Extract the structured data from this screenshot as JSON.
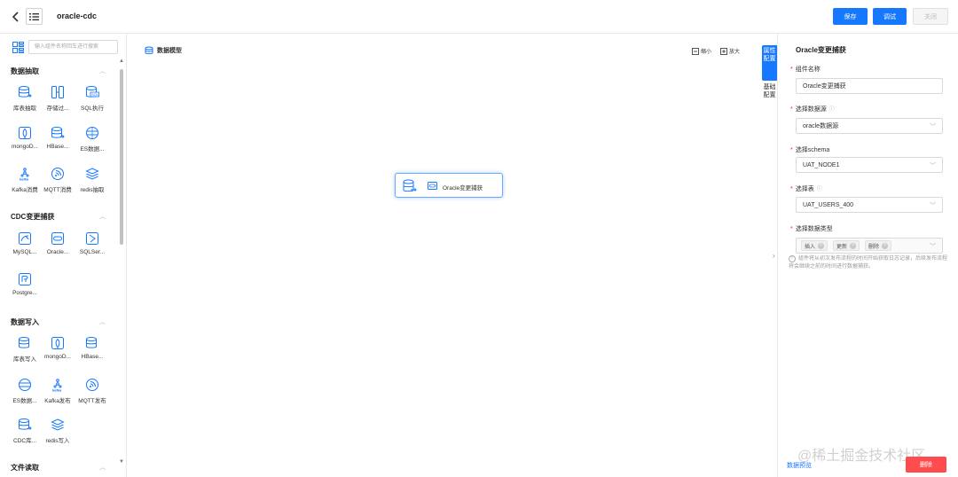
{
  "header": {
    "title": "oracle-cdc",
    "save_label": "保存",
    "debug_label": "调试",
    "close_label": "关闭"
  },
  "sidebar": {
    "search_placeholder": "输入组件名称回车进行搜索",
    "sections": [
      {
        "title": "数据抽取",
        "items": [
          "库表抽取",
          "存储过...",
          "SQL执行",
          "mongoD...",
          "HBase...",
          "ES数据...",
          "Kafka消费",
          "MQTT消费",
          "redis抽取"
        ]
      },
      {
        "title": "CDC变更捕获",
        "items": [
          "MySQL...",
          "Oracle...",
          "SQLSer...",
          "Postgre..."
        ]
      },
      {
        "title": "数据写入",
        "items": [
          "库表写入",
          "mongoD...",
          "HBase...",
          "ES数据...",
          "Kafka发布",
          "MQTT发布",
          "CDC库...",
          "redis写入"
        ]
      },
      {
        "title": "文件读取"
      }
    ]
  },
  "canvas": {
    "title": "数据模型",
    "zoom_out_label": "缩小",
    "zoom_in_label": "放大",
    "node_label": "Oracle变更捕获"
  },
  "tabs": {
    "properties": "属性配置",
    "basic": "基础配置"
  },
  "panel": {
    "title": "Oracle变更捕获",
    "component_name_label": "组件名称",
    "component_name_value": "Oracle变更捕获",
    "datasource_label": "选择数据源",
    "datasource_value": "oracle数据源",
    "schema_label": "选择schema",
    "schema_value": "UAT_NODE1",
    "table_label": "选择表",
    "table_value": "UAT_USERS_400",
    "data_type_label": "选择数据类型",
    "data_types": [
      "插入",
      "更新",
      "删除"
    ],
    "hint": "组件将从初次发布流程的时间开始获取日志记录，后续发布流程将会继续之前的时间进行数据捕获。",
    "preview_label": "数据预览",
    "delete_label": "删除"
  },
  "watermark": "@稀土掘金技术社区",
  "colors": {
    "primary": "#1677ff",
    "danger": "#ff4d4f"
  }
}
